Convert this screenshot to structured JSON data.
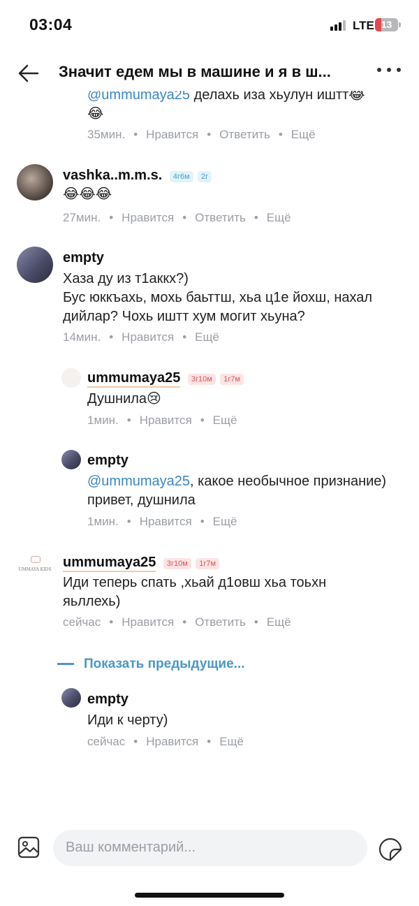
{
  "status_bar": {
    "time": "03:04",
    "network": "LTE",
    "battery": "13"
  },
  "header": {
    "title": "Значит едем мы в машине и я в ш..."
  },
  "comments": [
    {
      "name": "",
      "text_mention": "@ummumaya25",
      "text": " делахь иза хьулун иштт😂",
      "text2": "😂",
      "time": "35мин.",
      "like": "Нравится",
      "reply": "Ответить",
      "more": "Ещё"
    },
    {
      "name": "vashka..m.m.s.",
      "badges": [
        "4г6м",
        "2г"
      ],
      "text": "😂😂😂",
      "time": "27мин.",
      "like": "Нравится",
      "reply": "Ответить",
      "more": "Ещё"
    },
    {
      "name": "empty",
      "text": "Хаза ду из т1аккх?)\nБус юккъахь, мохь баьттш, хьа ц1е йохш, нахал дийлар? Чохь иштт хум могит хьуна?",
      "time": "14мин.",
      "like": "Нравится",
      "more": "Ещё"
    },
    {
      "name": "ummumaya25",
      "badges": [
        "3г10м",
        "1г7м"
      ],
      "text": "Душнила😢",
      "time": "1мин.",
      "like": "Нравится",
      "more": "Ещё"
    },
    {
      "name": "empty",
      "text_mention": "@ummumaya25",
      "text": ", какое необычное признание) привет, душнила",
      "time": "1мин.",
      "like": "Нравится",
      "more": "Ещё"
    },
    {
      "name": "ummumaya25",
      "badges": [
        "3г10м",
        "1г7м"
      ],
      "text": "Иди теперь спать ,хьай д1овш хьа тоьхн яьллехь)",
      "time": "сейчас",
      "like": "Нравится",
      "reply": "Ответить",
      "more": "Ещё"
    },
    {
      "name": "empty",
      "text": "Иди к черту)",
      "time": "сейчас",
      "like": "Нравится",
      "more": "Ещё"
    }
  ],
  "show_previous": "Показать предыдущие...",
  "composer": {
    "placeholder": "Ваш комментарий..."
  },
  "logo_text": "UMMAYA KIDS",
  "colors": {
    "accent": "#4a97c7",
    "mention": "#3a86c8",
    "meta": "#9a9ea5"
  }
}
